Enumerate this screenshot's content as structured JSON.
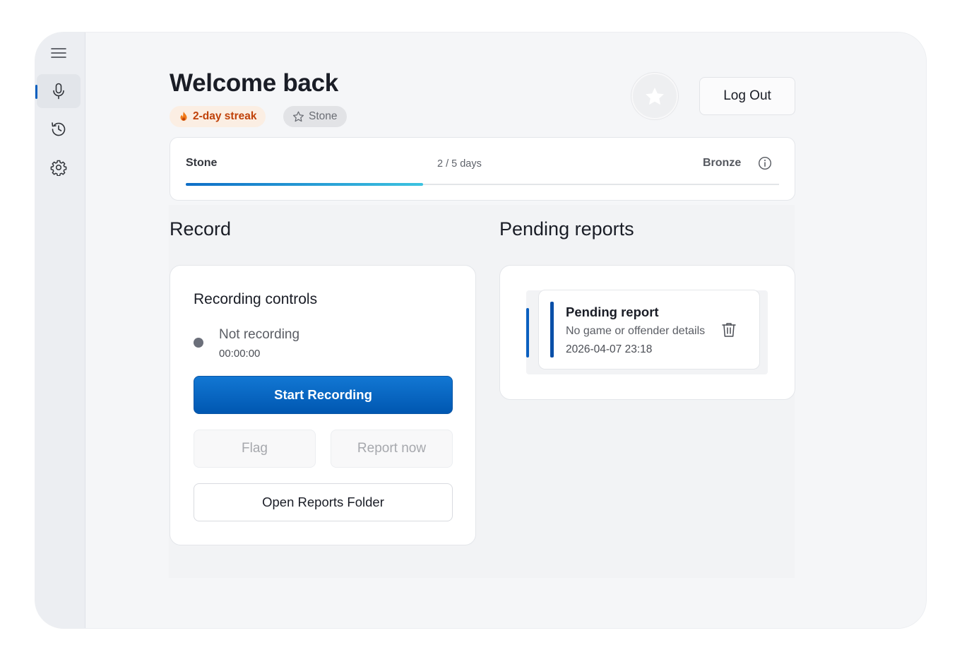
{
  "sidebar": {
    "items": [
      {
        "icon": "hamburger-menu-icon"
      },
      {
        "icon": "microphone-icon",
        "active": true
      },
      {
        "icon": "history-icon"
      },
      {
        "icon": "settings-gear-icon"
      }
    ]
  },
  "header": {
    "title": "Welcome back",
    "streak_label": "2-day streak",
    "rank_label": "Stone",
    "logout_label": "Log Out"
  },
  "progress": {
    "current_tier": "Stone",
    "days_text": "2 / 5 days",
    "next_tier": "Bronze",
    "fraction": 0.4
  },
  "record": {
    "section_title": "Record",
    "card_title": "Recording controls",
    "status": "Not recording",
    "timer": "00:00:00",
    "start_label": "Start Recording",
    "flag_label": "Flag",
    "report_now_label": "Report now",
    "open_folder_label": "Open Reports Folder"
  },
  "pending": {
    "section_title": "Pending reports",
    "items": [
      {
        "title": "Pending report",
        "subtitle": "No game or offender details",
        "date": "2026-04-07 23:18"
      }
    ]
  },
  "colors": {
    "accent": "#0a5fbf",
    "primary_button": "#0067c0",
    "streak_text": "#c0420a",
    "streak_bg": "#fbeee3"
  }
}
